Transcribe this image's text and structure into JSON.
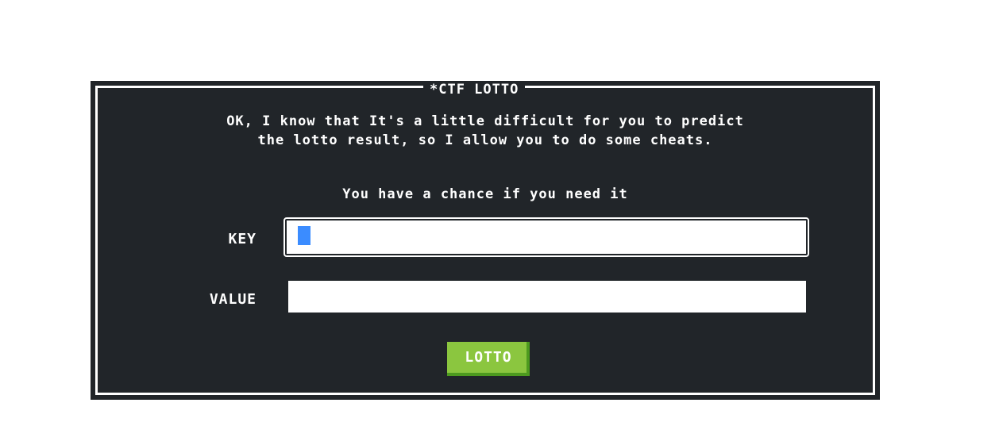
{
  "dialog": {
    "title": "*CTF LOTTO",
    "intro_line1": "OK, I know that It's a little difficult for you to predict",
    "intro_line2": "the lotto result, so I allow you to do some cheats.",
    "chance_text": "You have a chance if you need it"
  },
  "form": {
    "key_label": "KEY",
    "key_value": "",
    "value_label": "VALUE",
    "value_value": "",
    "submit_label": "LOTTO"
  },
  "colors": {
    "panel_background": "#212529",
    "border": "#ffffff",
    "caret": "#3b8cff",
    "button": "#8bc63f",
    "button_shadow": "#4d9a1f"
  }
}
